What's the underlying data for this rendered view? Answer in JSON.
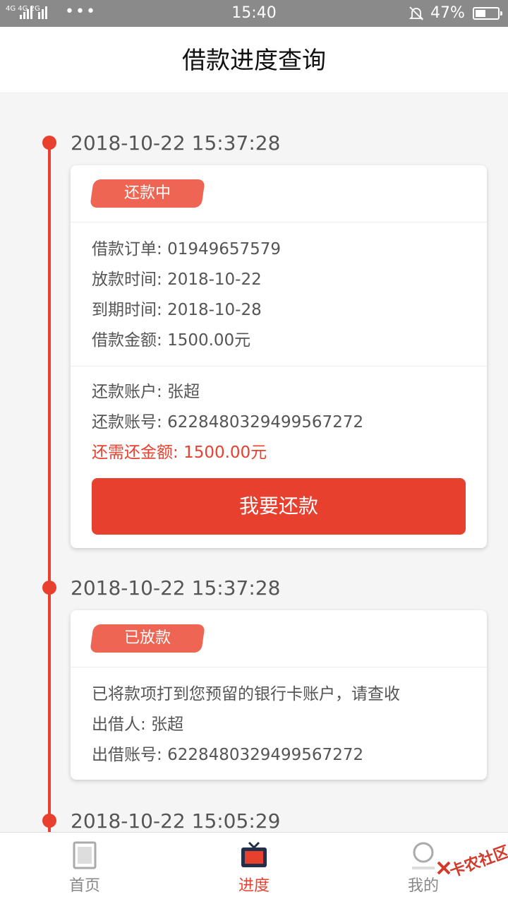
{
  "status_bar": {
    "network": "4G 4G 2G",
    "dots": "•••",
    "time": "15:40",
    "battery_percent": "47%"
  },
  "header": {
    "title": "借款进度查询"
  },
  "timeline": [
    {
      "timestamp": "2018-10-22 15:37:28",
      "status": "还款中",
      "order_label": "借款订单",
      "order_value": "01949657579",
      "disburse_label": "放款时间",
      "disburse_value": "2018-10-22",
      "due_label": "到期时间",
      "due_value": "2018-10-28",
      "amount_label": "借款金额",
      "amount_value": "1500.00元",
      "account_name_label": "还款账户",
      "account_name_value": "张超",
      "account_no_label": "还款账号",
      "account_no_value": "6228480329499567272",
      "remaining_label": "还需还金额",
      "remaining_value": "1500.00元",
      "repay_button": "我要还款"
    },
    {
      "timestamp": "2018-10-22 15:37:28",
      "status": "已放款",
      "message": "已将款项打到您预留的银行卡账户，请查收",
      "lender_label": "出借人",
      "lender_value": "张超",
      "lender_account_label": "出借账号",
      "lender_account_value": "6228480329499567272"
    },
    {
      "timestamp": "2018-10-22 15:05:29"
    }
  ],
  "tabbar": {
    "items": [
      {
        "label": "首页",
        "icon": "home-icon",
        "active": false
      },
      {
        "label": "进度",
        "icon": "progress-tv-icon",
        "active": true
      },
      {
        "label": "我的",
        "icon": "profile-icon",
        "active": false
      }
    ]
  },
  "watermark": {
    "text": "卡农社区"
  },
  "colors": {
    "accent": "#e8402f",
    "tag": "#ef6553",
    "text": "#555555"
  }
}
